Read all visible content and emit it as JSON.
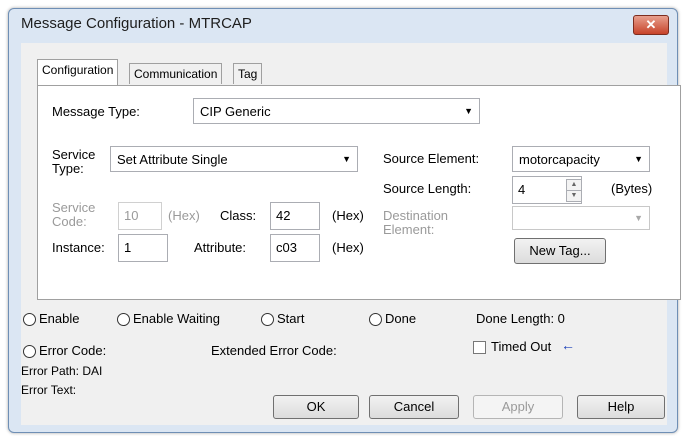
{
  "window": {
    "title": "Message Configuration - MTRCAP",
    "close_glyph": "✕"
  },
  "tabs": [
    {
      "label": "Configuration",
      "active": true
    },
    {
      "label": "Communication",
      "active": false
    },
    {
      "label": "Tag",
      "active": false
    }
  ],
  "config": {
    "message_type": {
      "label": "Message Type:",
      "value": "CIP Generic"
    },
    "service_type": {
      "label_line1": "Service",
      "label_line2": "Type:",
      "value": "Set Attribute Single"
    },
    "service_code": {
      "label_line1": "Service",
      "label_line2": "Code:",
      "value": "10",
      "unit": "(Hex)"
    },
    "class": {
      "label": "Class:",
      "value": "42",
      "unit": "(Hex)"
    },
    "instance": {
      "label": "Instance:",
      "value": "1"
    },
    "attribute": {
      "label": "Attribute:",
      "value": "c03",
      "unit": "(Hex)"
    },
    "source_element": {
      "label": "Source Element:",
      "value": "motorcapacity"
    },
    "source_length": {
      "label": "Source Length:",
      "value": "4",
      "unit": "(Bytes)"
    },
    "destination_element": {
      "label_line1": "Destination",
      "label_line2": "Element:",
      "value": ""
    },
    "new_tag_label": "New Tag..."
  },
  "status": {
    "enable": "Enable",
    "enable_waiting": "Enable Waiting",
    "start": "Start",
    "done": "Done",
    "done_length": "Done Length: 0",
    "error_code": "Error Code:",
    "extended_error_code": "Extended Error Code:",
    "timed_out": "Timed Out",
    "error_path": "Error Path: DAI",
    "error_text": "Error Text:"
  },
  "buttons": {
    "ok": "OK",
    "cancel": "Cancel",
    "apply": "Apply",
    "help": "Help"
  },
  "colors": {
    "title_bar": "#dbe6f3",
    "close_button": "#c7432a",
    "arrow_indicator": "#1a3fb8"
  }
}
